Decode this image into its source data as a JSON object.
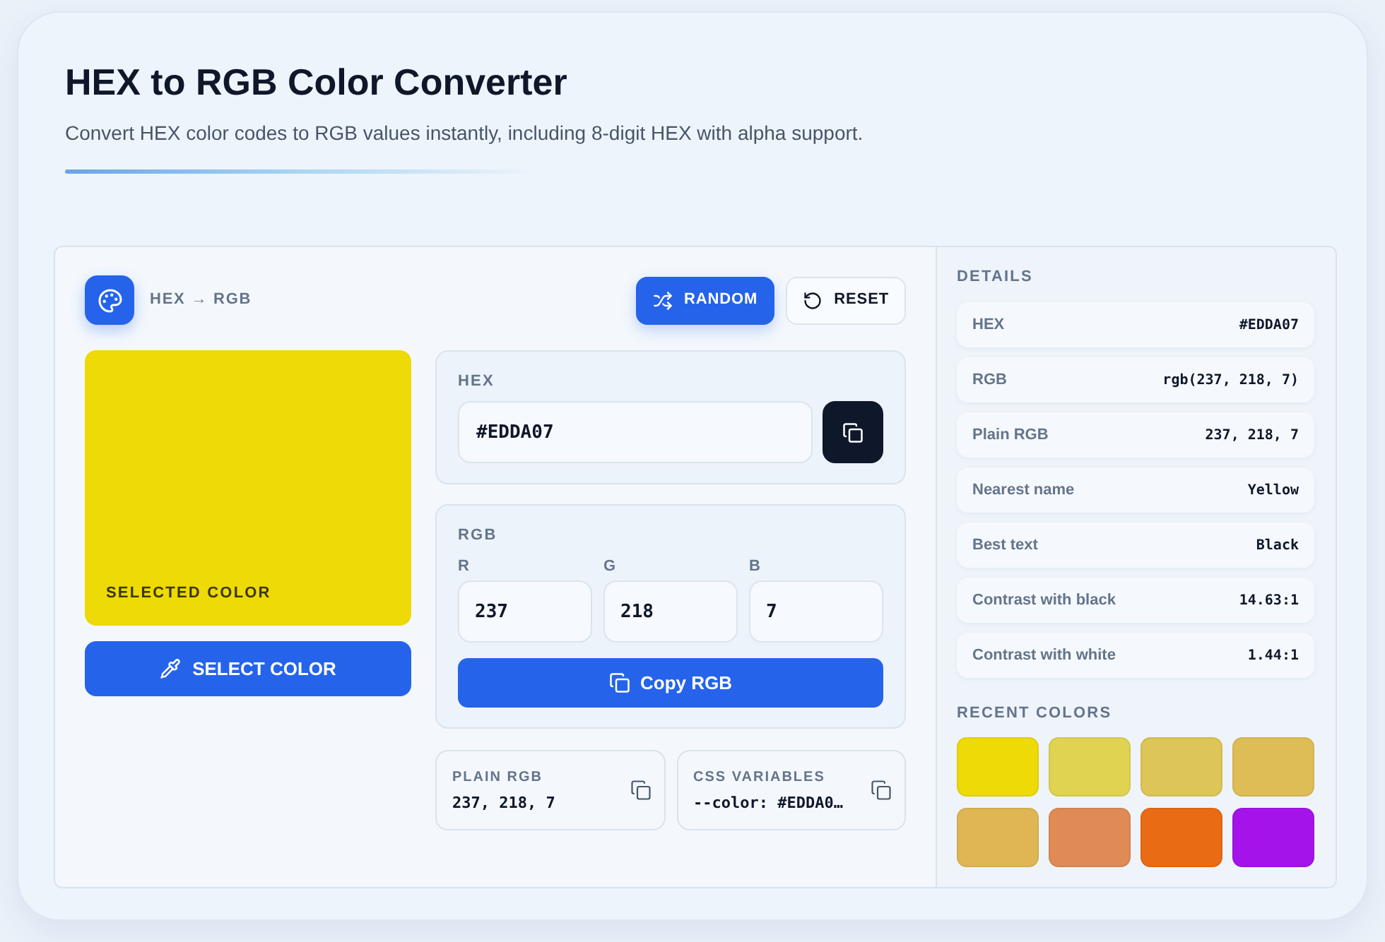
{
  "header": {
    "title": "HEX to RGB Color Converter",
    "subtitle": "Convert HEX color codes to RGB values instantly, including 8-digit HEX with alpha support."
  },
  "converter": {
    "mode": "HEX → RGB",
    "buttons": [
      {
        "kind": "primary",
        "label": "RANDOM"
      },
      {
        "kind": "outline",
        "label": "RESET"
      }
    ],
    "preview": {
      "label": "SELECTED COLOR",
      "color": "#edda07"
    },
    "select_button": "SELECT COLOR",
    "hex": {
      "label": "HEX",
      "value": "#EDDA07"
    },
    "rgb": {
      "label": "RGB",
      "channels": [
        {
          "label": "R",
          "value": "237"
        },
        {
          "label": "G",
          "value": "218"
        },
        {
          "label": "B",
          "value": "7"
        }
      ],
      "copy_button": "Copy RGB"
    },
    "outputs": [
      {
        "label": "PLAIN RGB",
        "value": "237, 218, 7"
      },
      {
        "label": "CSS VARIABLES",
        "value": "--color: #EDDA0…"
      }
    ]
  },
  "details": {
    "title": "DETAILS",
    "rows": [
      {
        "label": "HEX",
        "value": "#EDDA07"
      },
      {
        "label": "RGB",
        "value": "rgb(237, 218, 7)"
      },
      {
        "label": "Plain RGB",
        "value": "237, 218, 7"
      },
      {
        "label": "Nearest name",
        "value": "Yellow"
      },
      {
        "label": "Best text",
        "value": "Black"
      },
      {
        "label": "Contrast with black",
        "value": "14.63:1"
      },
      {
        "label": "Contrast with white",
        "value": "1.44:1"
      }
    ]
  },
  "recent_colors": {
    "title": "RECENT COLORS",
    "swatches": [
      {
        "color": "#edda07"
      },
      {
        "color": "#e0d352"
      },
      {
        "color": "#ddc657"
      },
      {
        "color": "#dfbd56"
      },
      {
        "color": "#dfb653"
      },
      {
        "color": "#e08b55"
      },
      {
        "color": "#e96c15"
      },
      {
        "color": "#a414ea"
      }
    ]
  }
}
